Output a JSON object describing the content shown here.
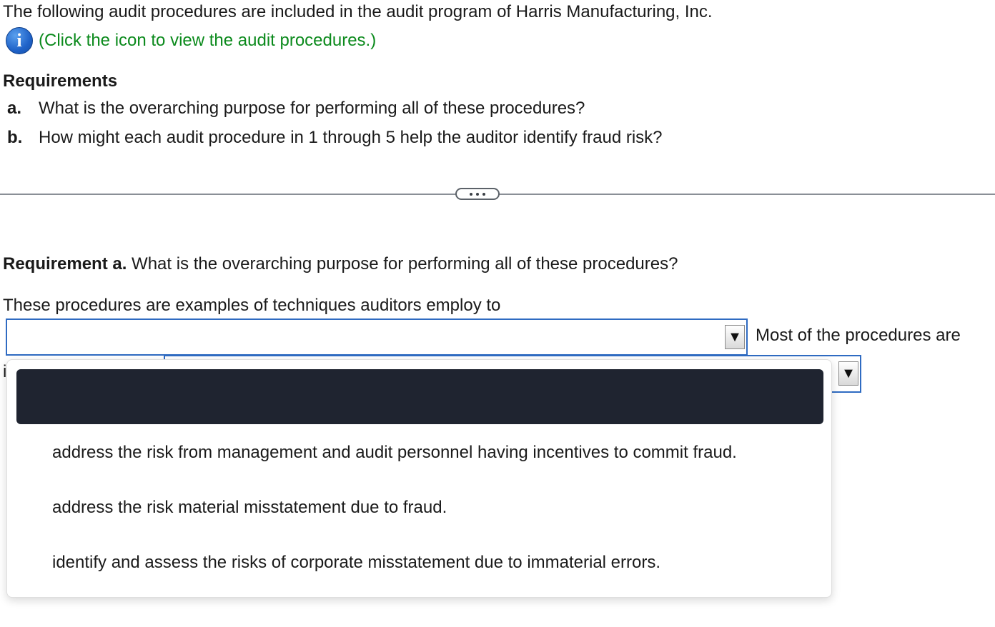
{
  "intro": {
    "text": "The following audit procedures are included in the audit program of Harris Manufacturing, Inc.",
    "info_icon_glyph": "i",
    "info_link": "(Click the icon to view the audit procedures.)"
  },
  "requirements": {
    "title": "Requirements",
    "items": [
      {
        "letter": "a.",
        "text": "What is the overarching purpose for performing all of these procedures?"
      },
      {
        "letter": "b.",
        "text": "How might each audit procedure in 1 through 5 help the auditor identify fraud risk?"
      }
    ]
  },
  "divider_button": {
    "icon": "ellipsis-icon"
  },
  "requirement_a": {
    "label": "Requirement a.",
    "question": " What is the overarching purpose for performing all of these procedures?",
    "sentence": "These procedures are examples of techniques auditors employ to",
    "select1": {
      "value": "",
      "arrow": "▼"
    },
    "most_text": "Most of the procedures are",
    "select2": {
      "value": "",
      "arrow": "▼"
    },
    "fragment": "i"
  },
  "dropdown": {
    "selected_option": "",
    "options": [
      "address the risk from management and audit personnel having incentives to commit fraud.",
      "address the risk material misstatement due to fraud.",
      "identify and assess the risks of corporate misstatement due to immaterial errors."
    ]
  },
  "colors": {
    "link_green": "#0b8a1c",
    "select_border_blue": "#2f6bc2",
    "highlight_dark": "#1f2430",
    "divider_gray": "#8a8f96"
  }
}
